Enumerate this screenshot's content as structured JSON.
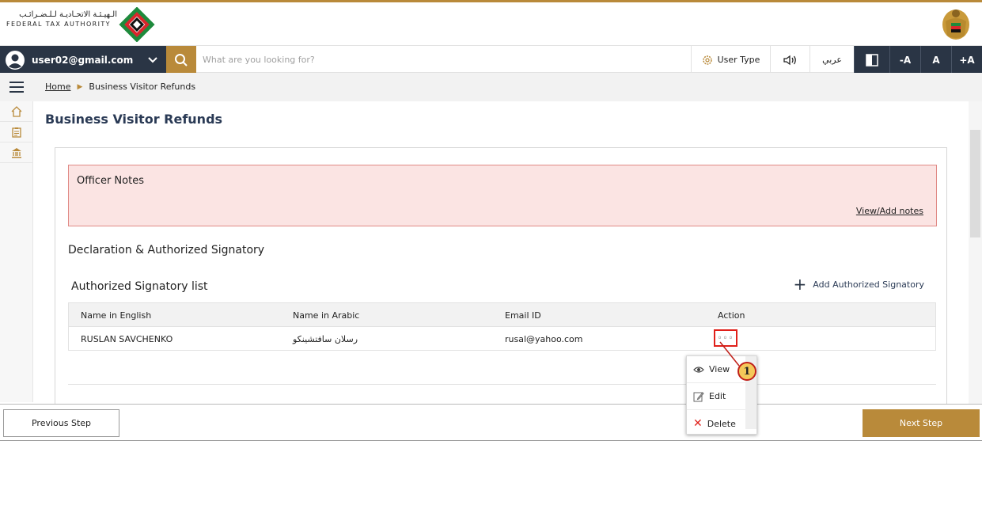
{
  "header": {
    "logo_arabic": "الـهيـئـة الاتحـاديـة لـلـضـرائـب",
    "logo_english": "FEDERAL TAX AUTHORITY"
  },
  "toolbar": {
    "user_email": "user02@gmail.com",
    "search_placeholder": "What are you looking for?",
    "user_type_label": "User Type",
    "language_label": "عربي",
    "font_decrease": "-A",
    "font_normal": "A",
    "font_increase": "+A"
  },
  "breadcrumb": {
    "home": "Home",
    "current": "Business Visitor Refunds"
  },
  "page": {
    "title": "Business Visitor Refunds"
  },
  "officer_notes": {
    "title": "Officer Notes",
    "link": "View/Add notes"
  },
  "declaration": {
    "section_title": "Declaration & Authorized Signatory",
    "list_title": "Authorized Signatory list",
    "add_label": "Add Authorized Signatory",
    "table": {
      "headers": [
        "Name in English",
        "Name in Arabic",
        "Email ID",
        "Action"
      ],
      "rows": [
        {
          "name_en": "RUSLAN SAVCHENKO",
          "name_ar": "رسلان سافتشينكو",
          "email": "rusal@yahoo.com",
          "action": "◦◦◦"
        }
      ]
    }
  },
  "action_menu": {
    "items": [
      {
        "label": "View",
        "icon": "eye-icon"
      },
      {
        "label": "Edit",
        "icon": "edit-icon"
      },
      {
        "label": "Delete",
        "icon": "close-icon"
      }
    ]
  },
  "callout": {
    "number": "1",
    "color": "#f4c95a",
    "border": "#c0201a"
  },
  "footer": {
    "previous": "Previous Step",
    "next": "Next Step"
  },
  "colors": {
    "gold": "#b98a3a",
    "navy": "#2a3545",
    "notes_bg": "#fbe4e3",
    "notes_border": "#e08a86",
    "highlight": "#e0201a"
  }
}
